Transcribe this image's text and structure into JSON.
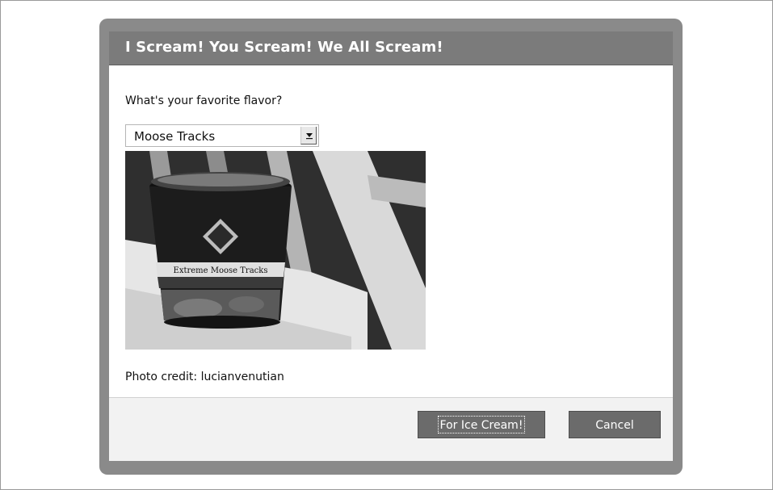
{
  "dialog": {
    "title": "I Scream! You Scream! We All Scream!",
    "prompt": "What's your favorite flavor?",
    "flavor_select": {
      "selected": "Moose Tracks"
    },
    "photo": {
      "label_text": "Extreme Moose Tracks"
    },
    "credit": "Photo credit: lucianvenutian",
    "buttons": {
      "submit_label": "For Ice Cream!",
      "cancel_label": "Cancel"
    }
  },
  "colors": {
    "frame_border": "#8a8a8a",
    "titlebar": "#7b7b7b",
    "button": "#6b6b6b",
    "footer": "#f2f2f2"
  }
}
